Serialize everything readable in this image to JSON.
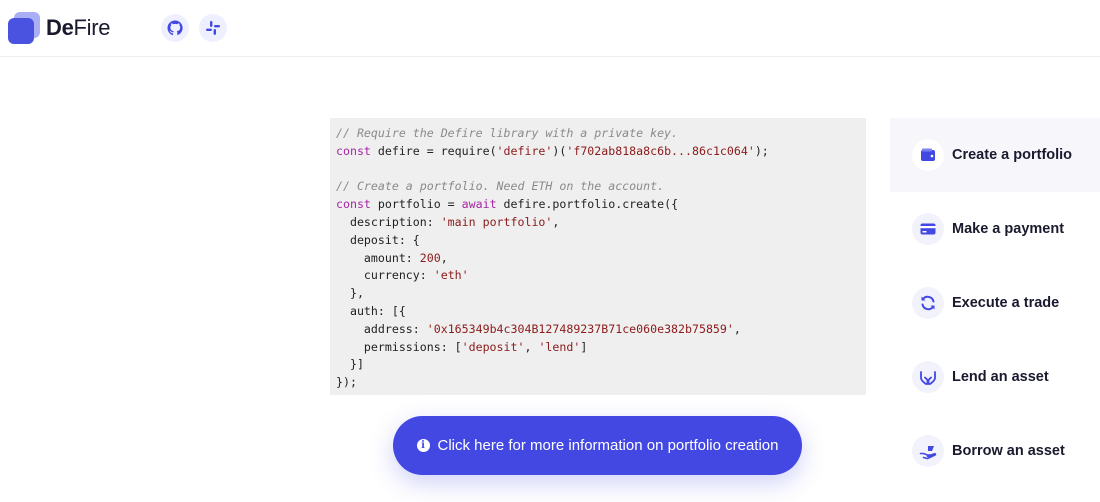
{
  "brand": {
    "bold": "De",
    "regular": "Fire"
  },
  "header_icons": [
    "github-icon",
    "slack-icon"
  ],
  "code": {
    "lines": [
      [
        {
          "t": "// Require the Defire library with a private key.",
          "c": "comment"
        }
      ],
      [
        {
          "t": "const",
          "c": "kw"
        },
        {
          "t": " defire = require(",
          "c": ""
        },
        {
          "t": "'defire'",
          "c": "str"
        },
        {
          "t": ")(",
          "c": ""
        },
        {
          "t": "'f702ab818a8c6b...86c1c064'",
          "c": "str"
        },
        {
          "t": ");",
          "c": ""
        }
      ],
      [],
      [
        {
          "t": "// Create a portfolio. Need ETH on the account.",
          "c": "comment"
        }
      ],
      [
        {
          "t": "const",
          "c": "kw"
        },
        {
          "t": " portfolio = ",
          "c": ""
        },
        {
          "t": "await",
          "c": "kw"
        },
        {
          "t": " defire.portfolio.create({",
          "c": ""
        }
      ],
      [
        {
          "t": "  description: ",
          "c": ""
        },
        {
          "t": "'main portfolio'",
          "c": "str"
        },
        {
          "t": ",",
          "c": ""
        }
      ],
      [
        {
          "t": "  deposit: {",
          "c": ""
        }
      ],
      [
        {
          "t": "    amount: ",
          "c": ""
        },
        {
          "t": "200",
          "c": "num"
        },
        {
          "t": ",",
          "c": ""
        }
      ],
      [
        {
          "t": "    currency: ",
          "c": ""
        },
        {
          "t": "'eth'",
          "c": "str"
        }
      ],
      [
        {
          "t": "  },",
          "c": ""
        }
      ],
      [
        {
          "t": "  auth: [{",
          "c": ""
        }
      ],
      [
        {
          "t": "    address: ",
          "c": ""
        },
        {
          "t": "'0x165349b4c304B127489237B71ce060e382b75859'",
          "c": "str"
        },
        {
          "t": ",",
          "c": ""
        }
      ],
      [
        {
          "t": "    permissions: [",
          "c": ""
        },
        {
          "t": "'deposit'",
          "c": "str"
        },
        {
          "t": ", ",
          "c": ""
        },
        {
          "t": "'lend'",
          "c": "str"
        },
        {
          "t": "]",
          "c": ""
        }
      ],
      [
        {
          "t": "  }]",
          "c": ""
        }
      ],
      [
        {
          "t": "});",
          "c": ""
        }
      ]
    ]
  },
  "info_button": {
    "label": "Click here for more information on portfolio creation",
    "icon": "info-icon"
  },
  "menu": {
    "items": [
      {
        "label": "Create a portfolio",
        "icon": "wallet-icon",
        "active": true
      },
      {
        "label": "Make a payment",
        "icon": "credit-card-icon",
        "active": false
      },
      {
        "label": "Execute a trade",
        "icon": "refresh-icon",
        "active": false
      },
      {
        "label": "Lend an asset",
        "icon": "hands-icon",
        "active": false
      },
      {
        "label": "Borrow an asset",
        "icon": "hand-holding-icon",
        "active": false
      }
    ]
  },
  "colors": {
    "accent": "#4348e3",
    "code_bg": "#efefef",
    "comment": "#8a8a8a",
    "keyword": "#a626a4",
    "string": "#8b1a1a"
  }
}
